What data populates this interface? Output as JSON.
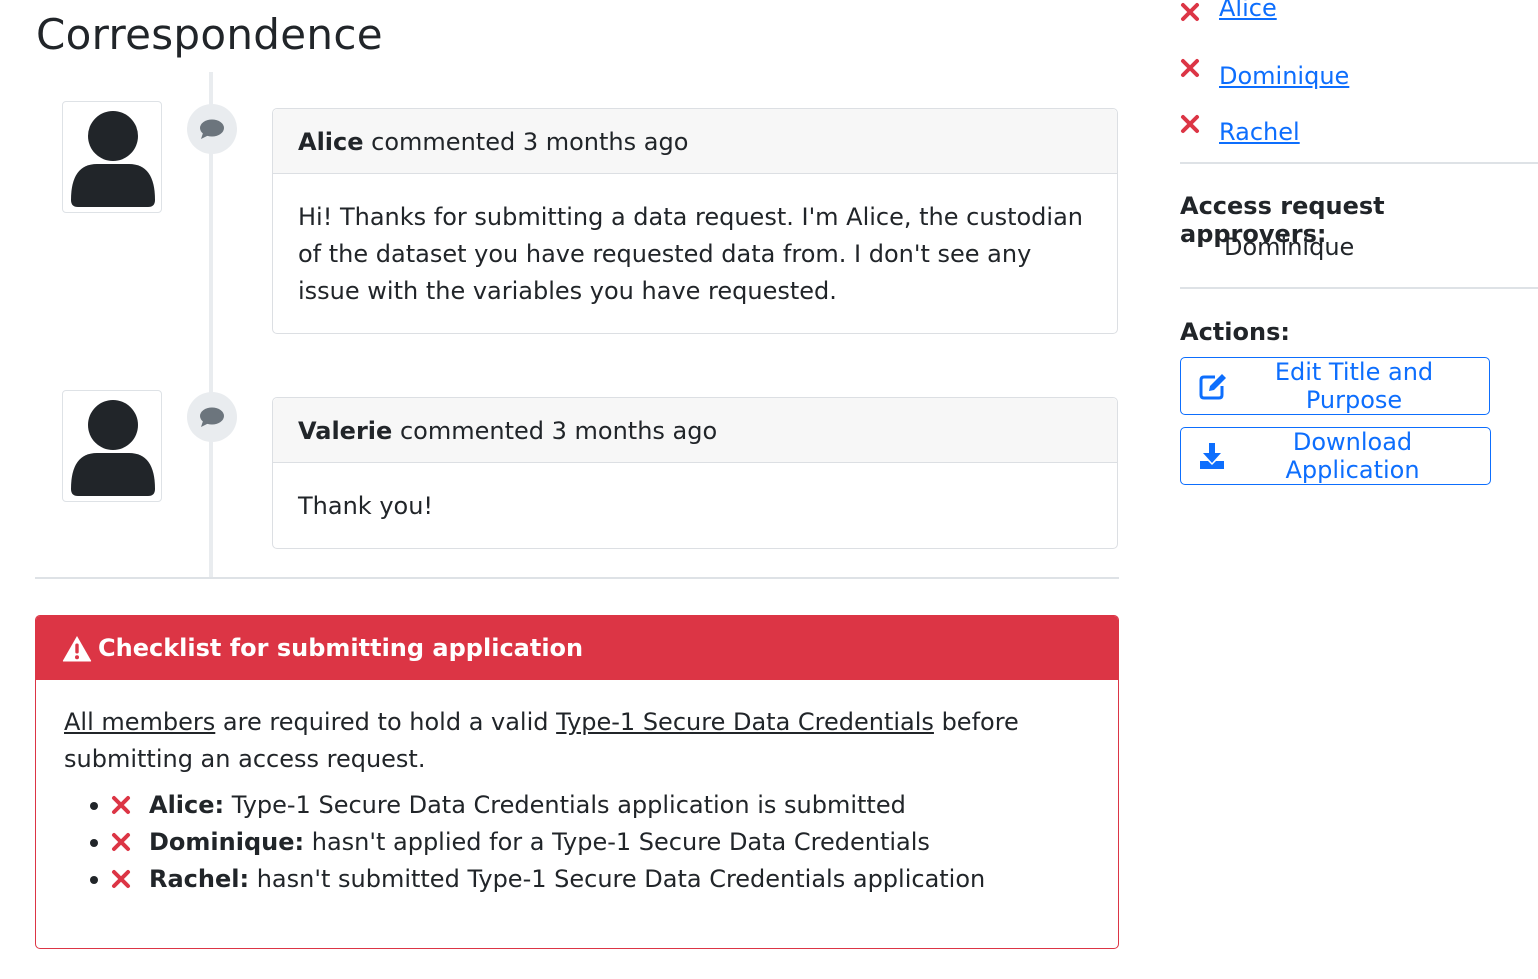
{
  "page": {
    "title": "Correspondence"
  },
  "comments": [
    {
      "author": "Alice",
      "meta": "commented 3 months ago",
      "body": "Hi! Thanks for submitting a data request. I'm Alice, the custodian of the dataset you have requested data from. I don't see any issue with the variables you have requested."
    },
    {
      "author": "Valerie",
      "meta": "commented 3 months ago",
      "body": "Thank you!"
    }
  ],
  "checklist": {
    "title": "Checklist for submitting application",
    "intro_link_members": "All members",
    "intro_text_1": " are required to hold a valid ",
    "intro_link_credentials": "Type-1 Secure Data Credentials",
    "intro_text_2": " before submitting an access request.",
    "items": [
      {
        "name": "Alice:",
        "status": " Type-1 Secure Data Credentials application is submitted"
      },
      {
        "name": "Dominique:",
        "status": " hasn't applied for a Type-1 Secure Data Credentials"
      },
      {
        "name": "Rachel:",
        "status": " hasn't submitted Type-1 Secure Data Credentials application"
      }
    ]
  },
  "sidebar": {
    "members": [
      "Alice",
      "Dominique",
      "Rachel"
    ],
    "approvers_heading": "Access request approvers:",
    "approvers": [
      "Dominique"
    ],
    "actions_heading": "Actions:",
    "edit_button": "Edit Title and Purpose",
    "download_button": "Download Application"
  },
  "colors": {
    "danger": "#dc3545",
    "primary": "#0d6efd",
    "text": "#212529"
  },
  "icons": [
    "user-icon",
    "comment-icon",
    "warning-icon",
    "x-icon",
    "edit-icon",
    "download-icon"
  ]
}
